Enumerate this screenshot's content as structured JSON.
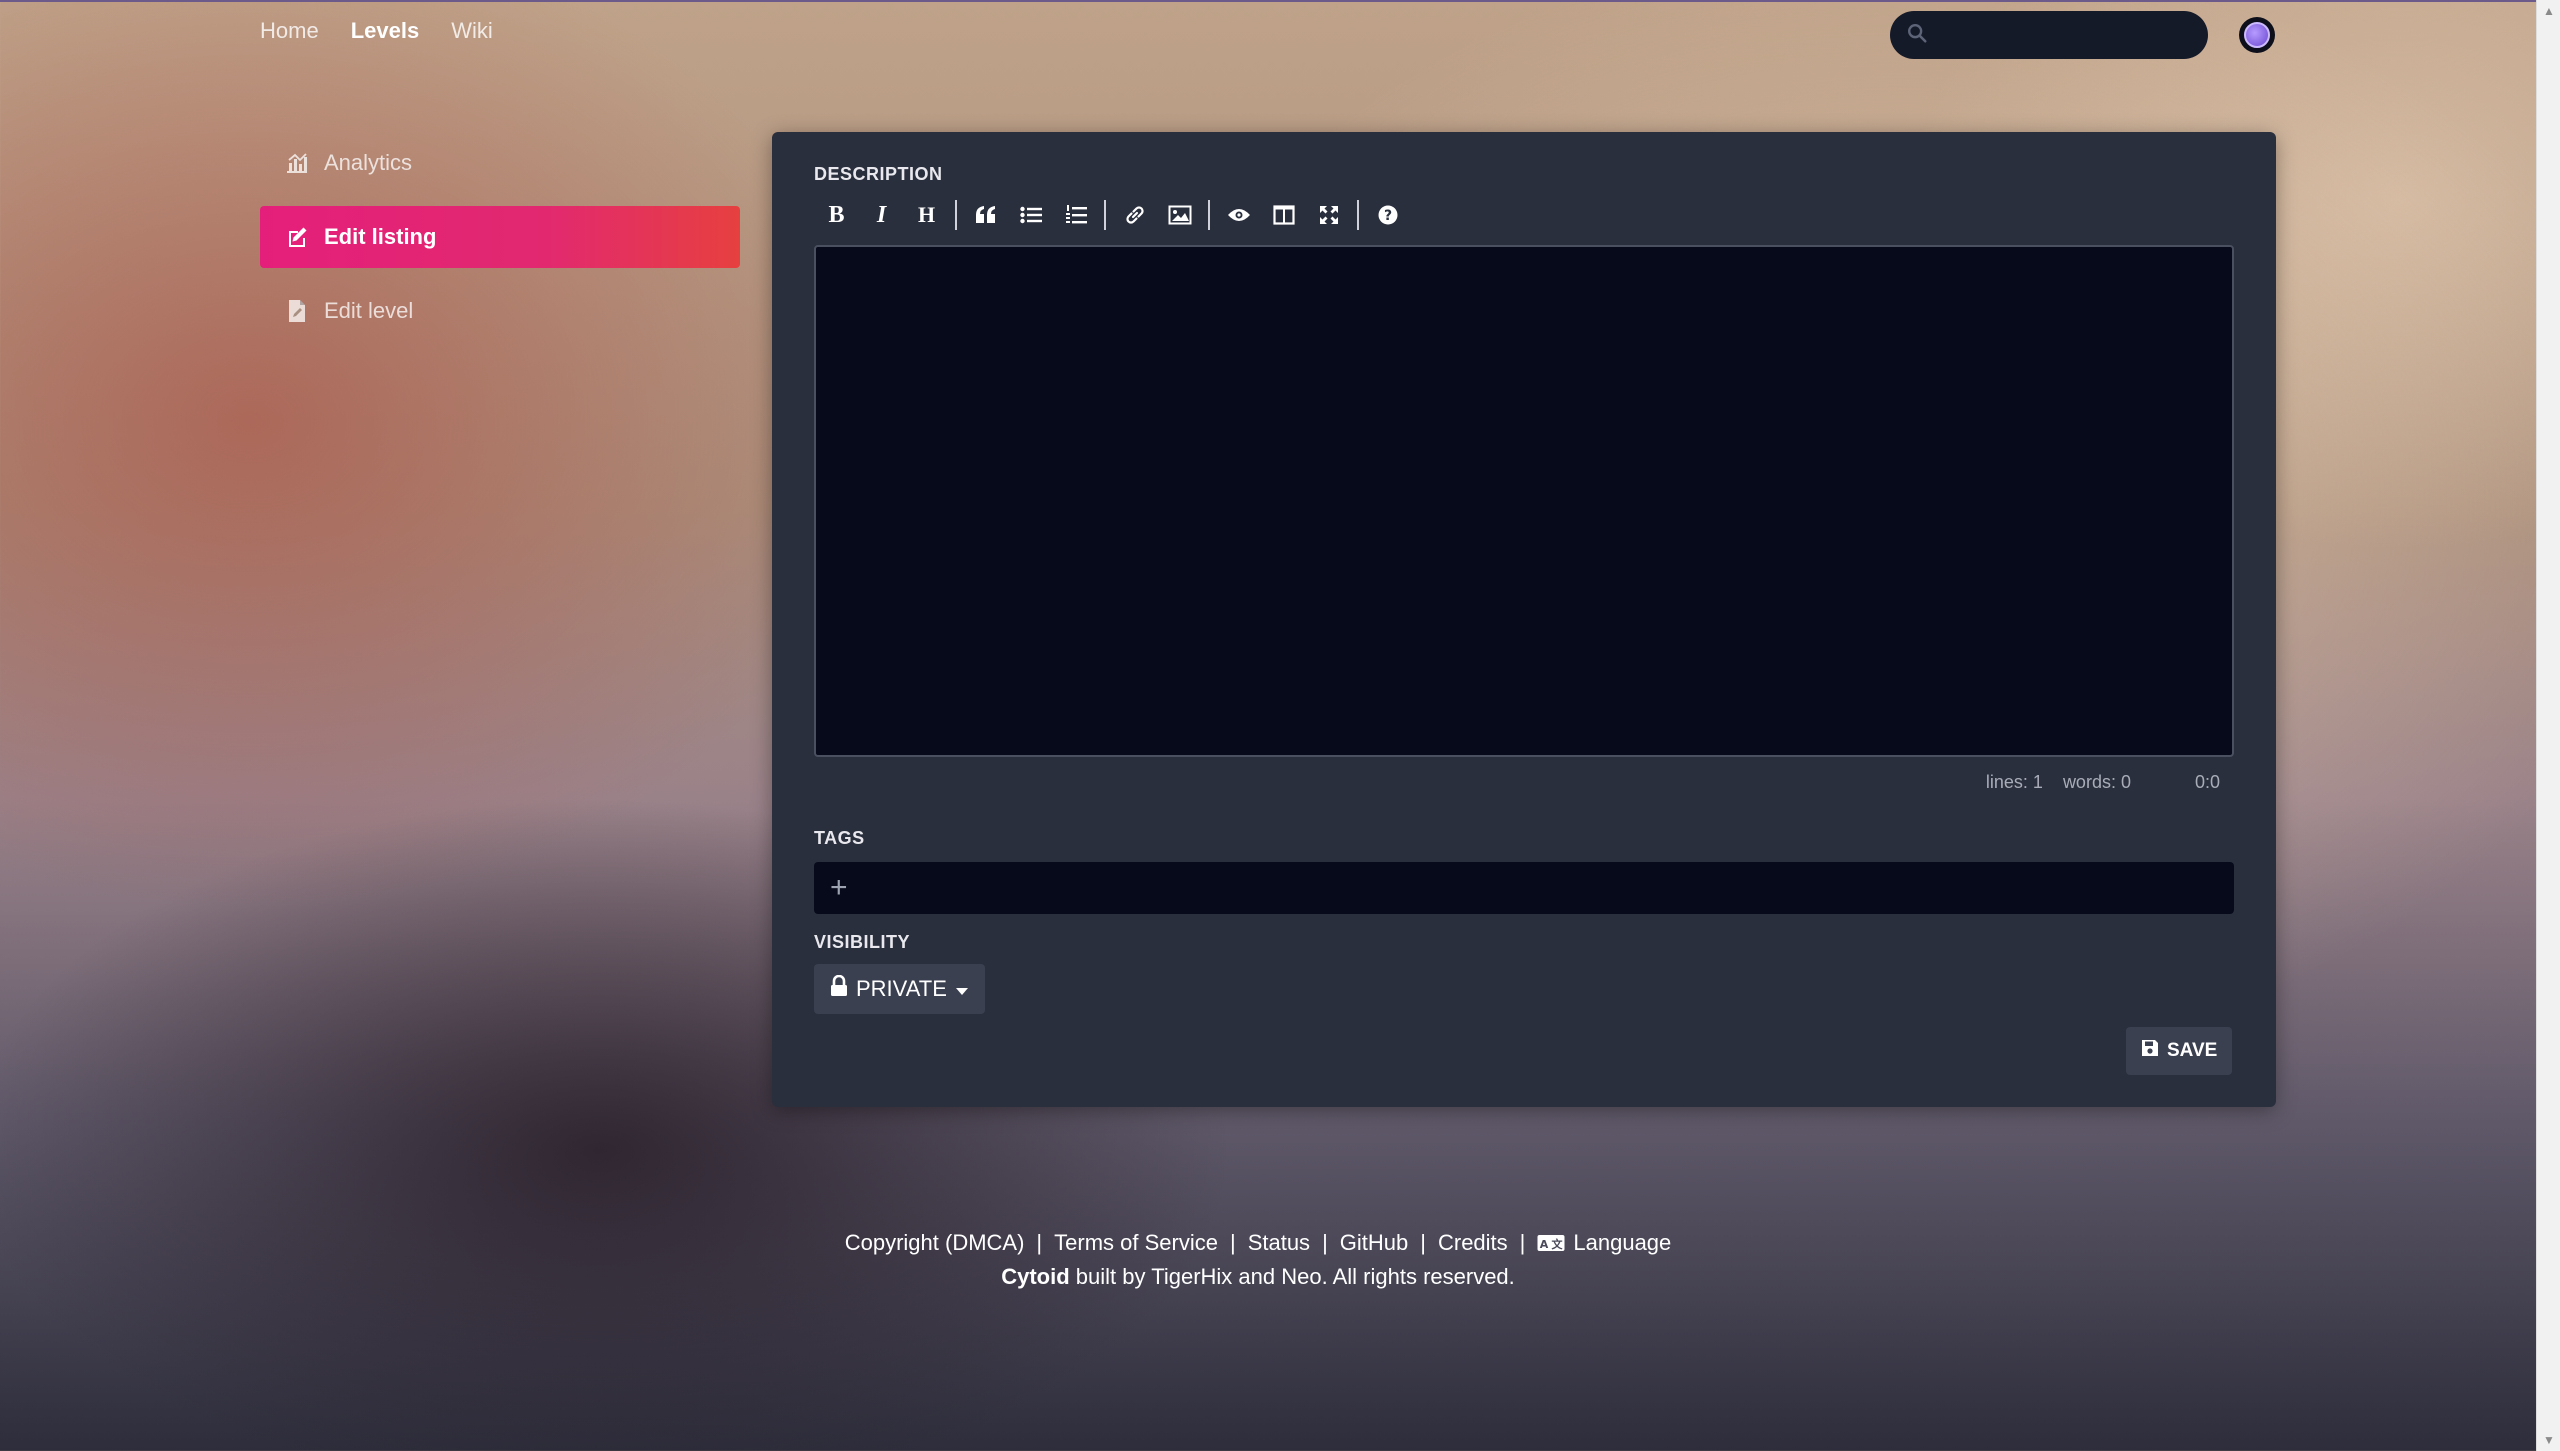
{
  "nav": {
    "items": [
      {
        "label": "Home",
        "active": false
      },
      {
        "label": "Levels",
        "active": true
      },
      {
        "label": "Wiki",
        "active": false
      }
    ]
  },
  "search": {
    "placeholder": ""
  },
  "sidebar": {
    "items": [
      {
        "label": "Analytics",
        "icon": "chart-icon",
        "active": false
      },
      {
        "label": "Edit listing",
        "icon": "edit-icon",
        "active": true
      },
      {
        "label": "Edit level",
        "icon": "file-edit-icon",
        "active": false
      }
    ]
  },
  "form": {
    "description_label": "DESCRIPTION",
    "toolbar": [
      "bold",
      "italic",
      "heading",
      "|",
      "quote",
      "unordered-list",
      "ordered-list",
      "|",
      "link",
      "image",
      "|",
      "preview",
      "side-by-side",
      "fullscreen",
      "|",
      "guide"
    ],
    "editor_value": "",
    "status": {
      "lines": "lines: 1",
      "words": "words: 0",
      "cursor": "0:0"
    },
    "tags_label": "TAGS",
    "tags_add": "+",
    "visibility_label": "VISIBILITY",
    "visibility_value": "PRIVATE",
    "save_label": "SAVE"
  },
  "footer": {
    "links": [
      "Copyright (DMCA)",
      "Terms of Service",
      "Status",
      "GitHub",
      "Credits",
      "Language"
    ],
    "brand": "Cytoid",
    "credit": "built by TigerHix and Neo. All rights reserved."
  },
  "colors": {
    "accent_start": "#e41f7b",
    "accent_end": "#e6403f",
    "card_bg": "#2a2f3d",
    "editor_bg": "#060a1b"
  }
}
